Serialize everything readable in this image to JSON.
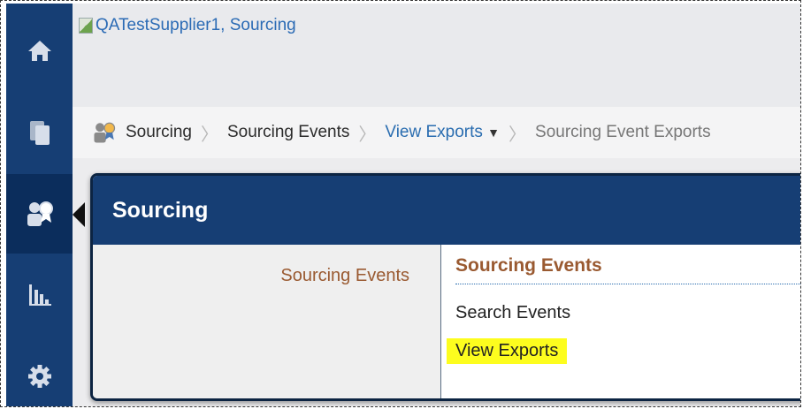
{
  "header": {
    "org_title": "QATestSupplier1, Sourcing"
  },
  "nav": {
    "items": [
      {
        "name": "home",
        "icon": "home-icon"
      },
      {
        "name": "documents",
        "icon": "documents-icon"
      },
      {
        "name": "sourcing",
        "icon": "sourcing-award-icon",
        "active": true
      },
      {
        "name": "analytics",
        "icon": "bar-chart-icon"
      },
      {
        "name": "settings",
        "icon": "gear-icon"
      }
    ]
  },
  "breadcrumb": {
    "items": [
      {
        "label": "Sourcing"
      },
      {
        "label": "Sourcing Events"
      },
      {
        "label": "View Exports"
      },
      {
        "label": "Sourcing Event Exports"
      }
    ]
  },
  "flyout": {
    "title": "Sourcing",
    "left_label": "Sourcing Events",
    "section_title": "Sourcing Events",
    "links": [
      {
        "label": "Search Events"
      },
      {
        "label": "View Exports"
      }
    ]
  },
  "colors": {
    "nav_bg": "#163e74",
    "accent_orange": "#9a5a31",
    "link_blue": "#2a6db0",
    "highlight": "#fdfd1e"
  }
}
